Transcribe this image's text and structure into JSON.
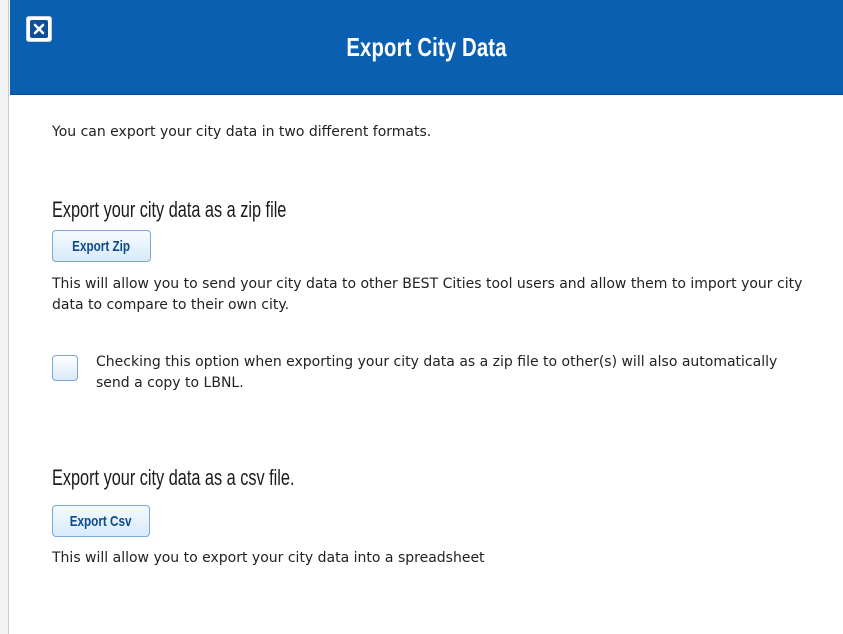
{
  "dialog": {
    "title": "Export City Data",
    "close_icon": "close-icon",
    "intro": "You can export your city data in two different formats."
  },
  "zip_section": {
    "heading": "Export your city data as a zip file",
    "button_label": "Export Zip",
    "description": "This will allow you to send your city data to other BEST Cities tool users and allow them to import your city data to compare to their own city.",
    "checkbox_checked": false,
    "checkbox_label": "Checking this option when exporting your city data as a zip file to other(s) will also automatically send a copy to LBNL."
  },
  "csv_section": {
    "heading": "Export your city data as a csv file.",
    "button_label": "Export Csv",
    "description": "This will allow you to export your city data into a spreadsheet"
  },
  "colors": {
    "header_bg": "#0b5fb0",
    "button_text": "#0d4a8c",
    "button_border": "#7aa8d8"
  }
}
